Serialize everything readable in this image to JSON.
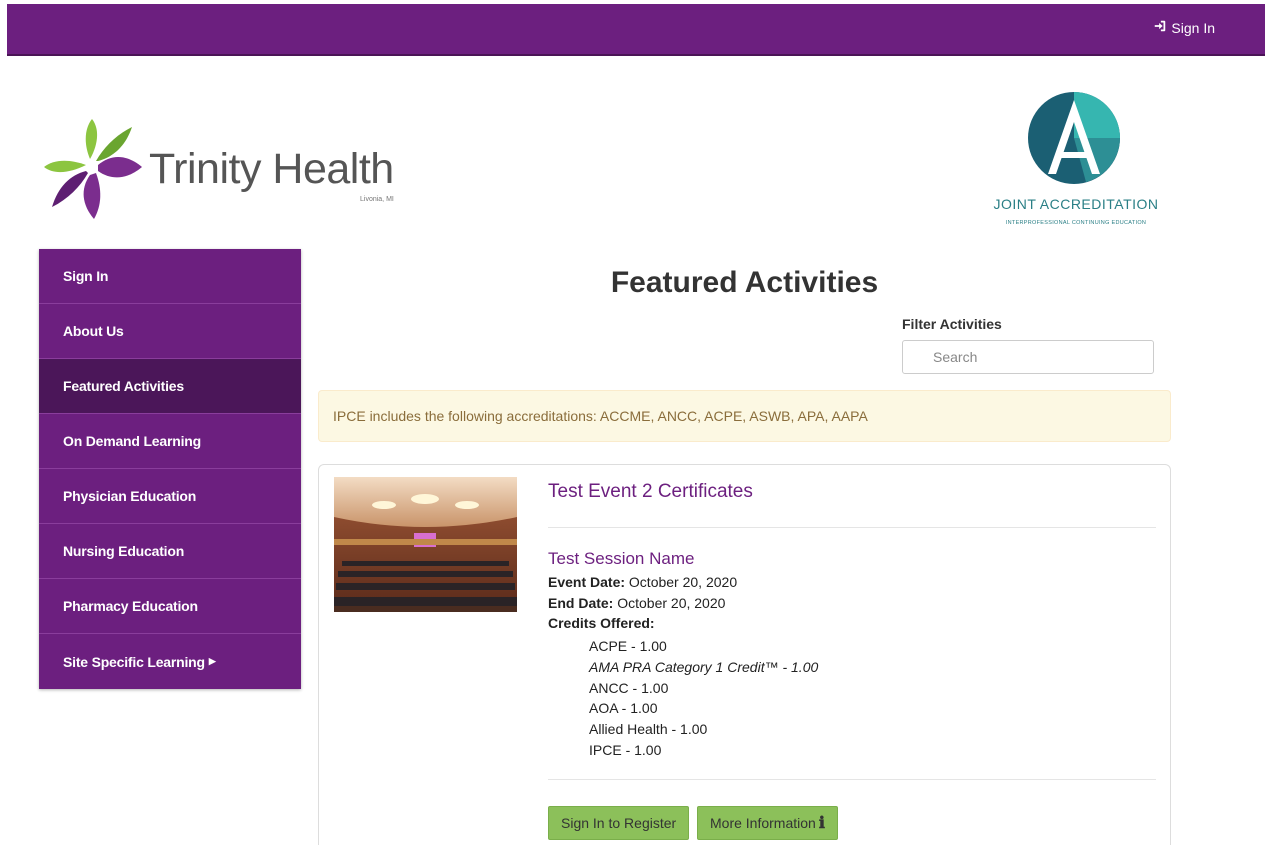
{
  "header": {
    "signin_label": "Sign In"
  },
  "branding": {
    "org_name": "Trinity Health",
    "org_location": "Livonia, MI",
    "accreditor_title": "JOINT ACCREDITATION",
    "accreditor_subtitle": "INTERPROFESSIONAL CONTINUING EDUCATION"
  },
  "sidebar": {
    "items": [
      {
        "label": "Sign In",
        "name": "sidebar-item-sign-in"
      },
      {
        "label": "About Us",
        "name": "sidebar-item-about-us"
      },
      {
        "label": "Featured Activities",
        "name": "sidebar-item-featured-activities"
      },
      {
        "label": "On Demand Learning",
        "name": "sidebar-item-on-demand-learning"
      },
      {
        "label": "Physician Education",
        "name": "sidebar-item-physician-education"
      },
      {
        "label": "Nursing Education",
        "name": "sidebar-item-nursing-education"
      },
      {
        "label": "Pharmacy Education",
        "name": "sidebar-item-pharmacy-education"
      },
      {
        "label": "Site Specific Learning",
        "name": "sidebar-item-site-specific-learning"
      }
    ]
  },
  "main": {
    "title": "Featured Activities",
    "filter_label": "Filter Activities",
    "search_placeholder": "Search",
    "alert_text": "IPCE includes the following accreditations: ACCME, ANCC, ACPE, ASWB, APA, AAPA"
  },
  "activity": {
    "title": "Test Event 2 Certificates",
    "session_name": "Test Session Name",
    "event_date_label": "Event Date:",
    "event_date": "October 20, 2020",
    "end_date_label": "End Date:",
    "end_date": "October 20, 2020",
    "credits_label": "Credits Offered:",
    "credits": [
      "ACPE - 1.00",
      "AMA PRA Category 1 Credit™ - 1.00",
      "ANCC - 1.00",
      "AOA - 1.00",
      "Allied Health - 1.00",
      "IPCE - 1.00"
    ],
    "register_label": "Sign In to Register",
    "more_info_label": "More Information"
  },
  "colors": {
    "brand_purple": "#6c1f7f",
    "active_purple": "#4b1659",
    "button_green": "#8cc05a",
    "alert_bg": "#fcf8e3"
  },
  "icons": {
    "signin": "sign-in-icon",
    "caret": "caret-right-icon",
    "info": "info-icon"
  }
}
